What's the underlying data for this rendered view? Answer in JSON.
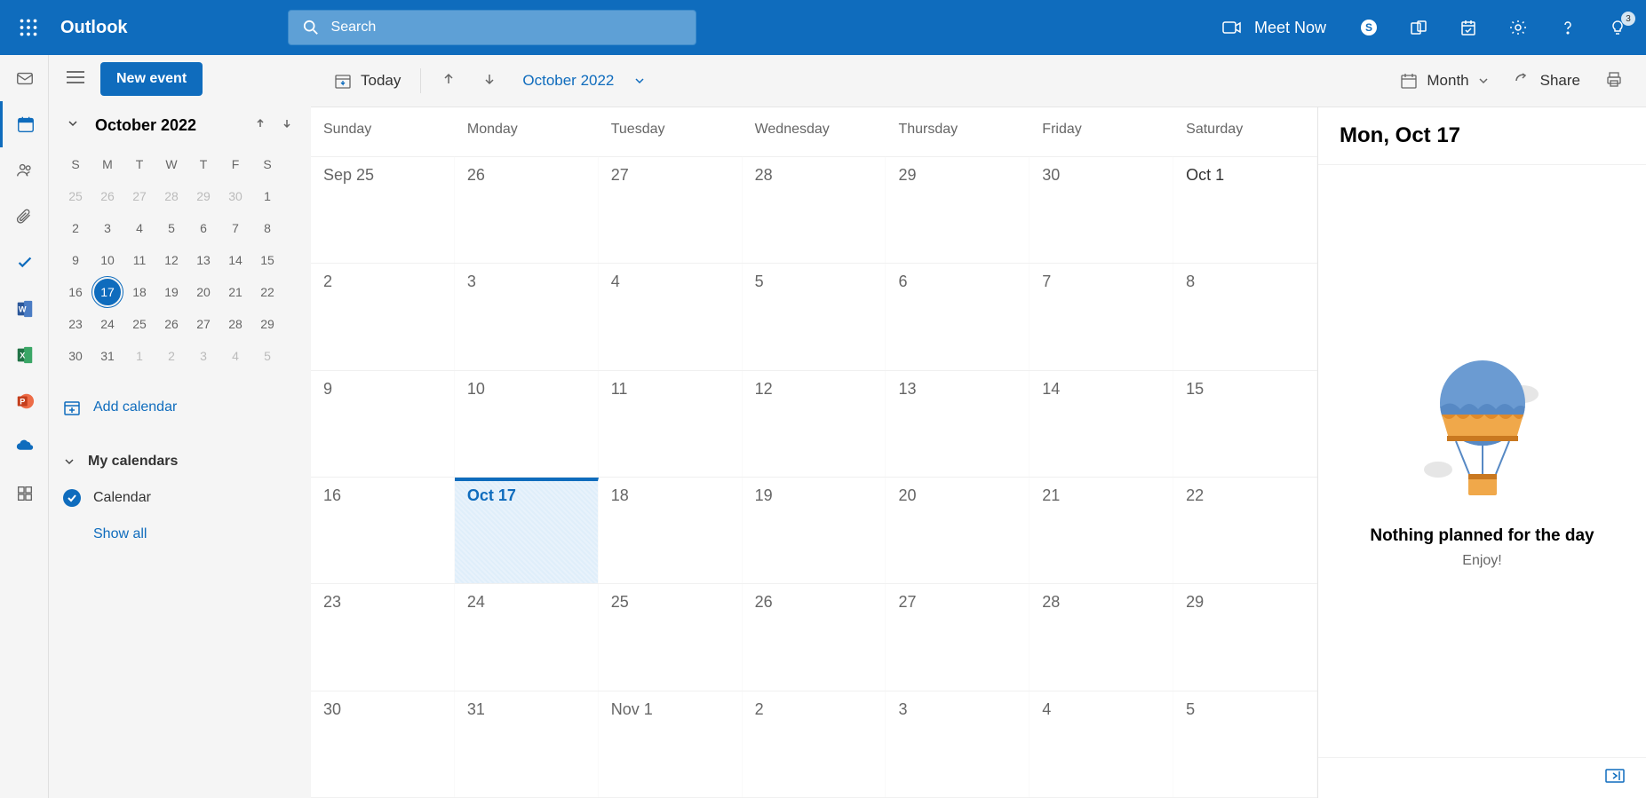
{
  "header": {
    "brand": "Outlook",
    "search_placeholder": "Search",
    "meet_now": "Meet Now",
    "notification_count": "3"
  },
  "sidebar": {
    "new_event": "New event",
    "mini_month": "October 2022",
    "day_headers": [
      "S",
      "M",
      "T",
      "W",
      "T",
      "F",
      "S"
    ],
    "weeks": [
      [
        {
          "d": "25",
          "dim": true
        },
        {
          "d": "26",
          "dim": true
        },
        {
          "d": "27",
          "dim": true
        },
        {
          "d": "28",
          "dim": true
        },
        {
          "d": "29",
          "dim": true
        },
        {
          "d": "30",
          "dim": true
        },
        {
          "d": "1"
        }
      ],
      [
        {
          "d": "2"
        },
        {
          "d": "3"
        },
        {
          "d": "4"
        },
        {
          "d": "5"
        },
        {
          "d": "6"
        },
        {
          "d": "7"
        },
        {
          "d": "8"
        }
      ],
      [
        {
          "d": "9"
        },
        {
          "d": "10"
        },
        {
          "d": "11"
        },
        {
          "d": "12"
        },
        {
          "d": "13"
        },
        {
          "d": "14"
        },
        {
          "d": "15"
        }
      ],
      [
        {
          "d": "16"
        },
        {
          "d": "17",
          "today": true
        },
        {
          "d": "18"
        },
        {
          "d": "19"
        },
        {
          "d": "20"
        },
        {
          "d": "21"
        },
        {
          "d": "22"
        }
      ],
      [
        {
          "d": "23"
        },
        {
          "d": "24"
        },
        {
          "d": "25"
        },
        {
          "d": "26"
        },
        {
          "d": "27"
        },
        {
          "d": "28"
        },
        {
          "d": "29"
        }
      ],
      [
        {
          "d": "30"
        },
        {
          "d": "31"
        },
        {
          "d": "1",
          "dim": true
        },
        {
          "d": "2",
          "dim": true
        },
        {
          "d": "3",
          "dim": true
        },
        {
          "d": "4",
          "dim": true
        },
        {
          "d": "5",
          "dim": true
        }
      ]
    ],
    "add_calendar": "Add calendar",
    "my_calendars": "My calendars",
    "calendar_item": "Calendar",
    "show_all": "Show all"
  },
  "toolbar": {
    "today": "Today",
    "month_label": "October 2022",
    "view": "Month",
    "share": "Share"
  },
  "grid": {
    "day_names": [
      "Sunday",
      "Monday",
      "Tuesday",
      "Wednesday",
      "Thursday",
      "Friday",
      "Saturday"
    ],
    "weeks": [
      [
        {
          "l": "Sep 25"
        },
        {
          "l": "26"
        },
        {
          "l": "27"
        },
        {
          "l": "28"
        },
        {
          "l": "29"
        },
        {
          "l": "30"
        },
        {
          "l": "Oct 1",
          "bold": true
        }
      ],
      [
        {
          "l": "2"
        },
        {
          "l": "3"
        },
        {
          "l": "4"
        },
        {
          "l": "5"
        },
        {
          "l": "6"
        },
        {
          "l": "7"
        },
        {
          "l": "8"
        }
      ],
      [
        {
          "l": "9"
        },
        {
          "l": "10"
        },
        {
          "l": "11"
        },
        {
          "l": "12"
        },
        {
          "l": "13"
        },
        {
          "l": "14"
        },
        {
          "l": "15"
        }
      ],
      [
        {
          "l": "16"
        },
        {
          "l": "Oct 17",
          "today": true
        },
        {
          "l": "18"
        },
        {
          "l": "19"
        },
        {
          "l": "20"
        },
        {
          "l": "21"
        },
        {
          "l": "22"
        }
      ],
      [
        {
          "l": "23"
        },
        {
          "l": "24"
        },
        {
          "l": "25"
        },
        {
          "l": "26"
        },
        {
          "l": "27"
        },
        {
          "l": "28"
        },
        {
          "l": "29"
        }
      ],
      [
        {
          "l": "30"
        },
        {
          "l": "31"
        },
        {
          "l": "Nov 1"
        },
        {
          "l": "2"
        },
        {
          "l": "3"
        },
        {
          "l": "4"
        },
        {
          "l": "5"
        }
      ]
    ]
  },
  "panel": {
    "title": "Mon, Oct 17",
    "empty_title": "Nothing planned for the day",
    "empty_sub": "Enjoy!"
  }
}
